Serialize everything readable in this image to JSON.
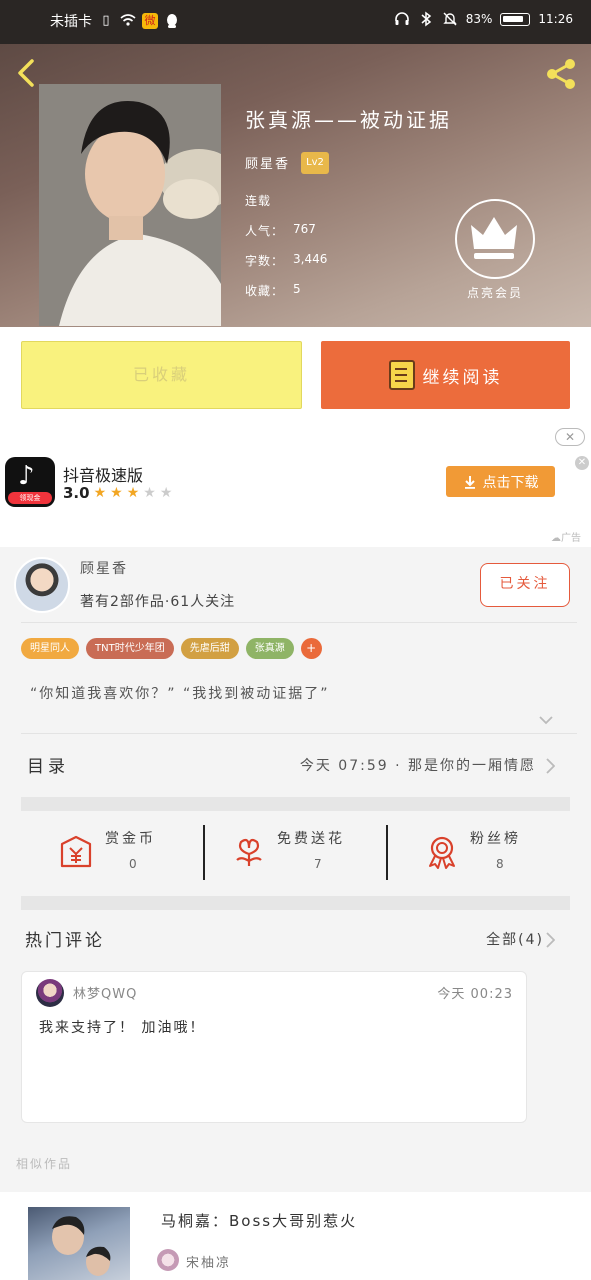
{
  "status_bar": {
    "carrier": "未插卡",
    "battery": "83%",
    "time": "11:26"
  },
  "hero": {
    "title": "张真源——被动证据",
    "author": "顾星香",
    "level": "Lv2",
    "status": "连载",
    "popularity_label": "人气：",
    "popularity": "767",
    "words_label": "字数：",
    "words": "3,446",
    "favorites_label": "收藏：",
    "favorites": "5",
    "vip_label": "点亮会员"
  },
  "actions": {
    "collected_label": "已收藏",
    "continue_label": "继续阅读"
  },
  "ad": {
    "app_name": "抖音极速版",
    "icon_badge": "领现金",
    "rating": "3.0",
    "stars_on": 3,
    "download_label": "点击下载",
    "ad_tag": "广告",
    "close_pill": "✕",
    "close_x": "✕"
  },
  "author_section": {
    "name": "顾星香",
    "desc": "著有2部作品·61人关注",
    "follow_label": "已关注"
  },
  "tags": [
    {
      "label": "明星同人",
      "color": "#f1a940"
    },
    {
      "label": "TNT时代少年团",
      "color": "#c96c55"
    },
    {
      "label": "先虐后甜",
      "color": "#d2a042"
    },
    {
      "label": "张真源",
      "color": "#8fb466"
    },
    {
      "label": "+",
      "color": "#ea6a3a"
    }
  ],
  "summary": "“你知道我喜欢你？” “我找到被动证据了”",
  "toc": {
    "label": "目录",
    "latest": "今天 07:59 · 那是你的一厢情愿"
  },
  "stats": [
    {
      "label": "赏金币",
      "value": "0",
      "icon": "coin-gift-icon"
    },
    {
      "label": "免费送花",
      "value": "7",
      "icon": "flower-icon"
    },
    {
      "label": "粉丝榜",
      "value": "8",
      "icon": "medal-icon"
    }
  ],
  "hot_comments": {
    "title": "热门评论",
    "all_label": "全部(4)",
    "items": [
      {
        "user": "林梦QWQ",
        "time": "今天 00:23",
        "text": "我来支持了！ 加油哦！"
      }
    ]
  },
  "similar": {
    "title": "相似作品",
    "items": [
      {
        "title": "马桐嘉：Boss大哥别惹火",
        "author": "宋柚凉"
      }
    ]
  },
  "colors": {
    "accent_orange": "#ec6c3c",
    "collected_yellow": "#f9f27e",
    "icon_red": "#d9412b",
    "download_orange": "#f19a36"
  }
}
